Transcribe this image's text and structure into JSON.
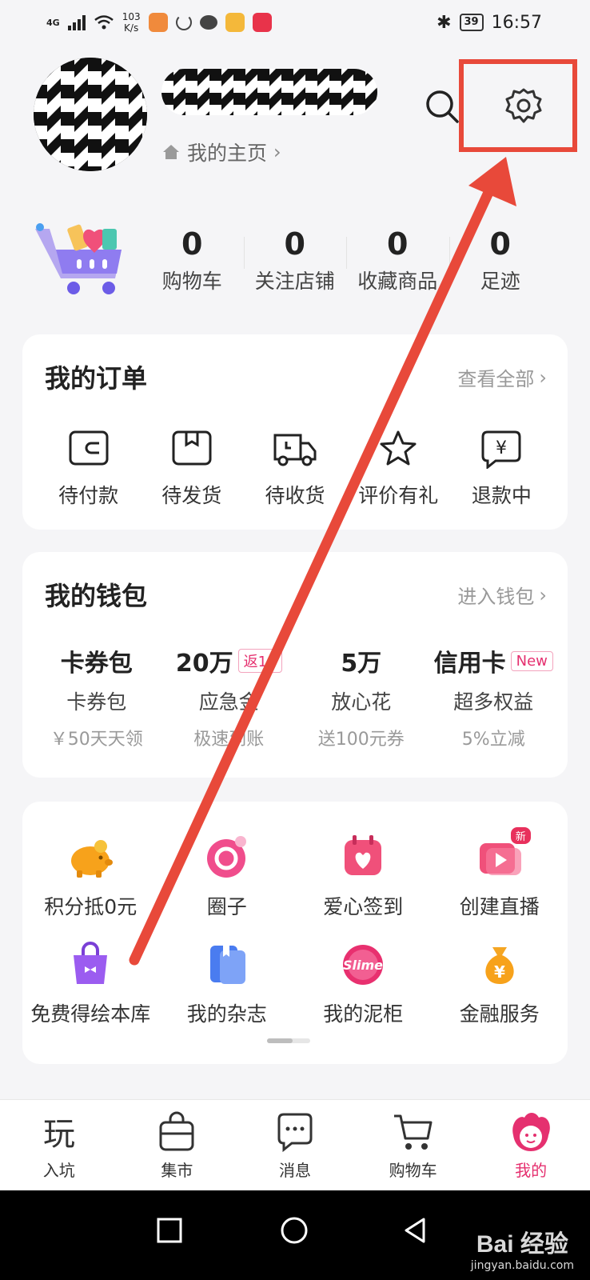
{
  "status_bar": {
    "network": "4G",
    "speed": "103",
    "speed_unit": "K/s",
    "battery": "39",
    "time": "16:57"
  },
  "profile": {
    "homepage_label": "我的主页"
  },
  "stats": [
    {
      "value": "0",
      "label": "购物车"
    },
    {
      "value": "0",
      "label": "关注店铺"
    },
    {
      "value": "0",
      "label": "收藏商品"
    },
    {
      "value": "0",
      "label": "足迹"
    }
  ],
  "orders": {
    "title": "我的订单",
    "view_all": "查看全部",
    "items": [
      {
        "label": "待付款",
        "icon": "wallet-icon"
      },
      {
        "label": "待发货",
        "icon": "package-icon"
      },
      {
        "label": "待收货",
        "icon": "truck-icon"
      },
      {
        "label": "评价有礼",
        "icon": "star-icon"
      },
      {
        "label": "退款中",
        "icon": "refund-icon"
      }
    ]
  },
  "wallet": {
    "title": "我的钱包",
    "enter": "进入钱包",
    "items": [
      {
        "value": "卡券包",
        "badge": "",
        "name": "卡券包",
        "sub": "￥50天天领"
      },
      {
        "value": "20万",
        "badge": "返18",
        "name": "应急金",
        "sub": "极速到账"
      },
      {
        "value": "5万",
        "badge": "",
        "name": "放心花",
        "sub": "送100元券"
      },
      {
        "value": "信用卡",
        "badge": "New",
        "name": "超多权益",
        "sub": "5%立减"
      }
    ]
  },
  "services": [
    {
      "label": "积分抵0元",
      "icon": "piggy-bank-icon"
    },
    {
      "label": "圈子",
      "icon": "circle-icon"
    },
    {
      "label": "爱心签到",
      "icon": "heart-calendar-icon"
    },
    {
      "label": "创建直播",
      "icon": "live-icon",
      "tag": "新"
    },
    {
      "label": "免费得绘本库",
      "icon": "gift-bag-icon"
    },
    {
      "label": "我的杂志",
      "icon": "magazine-icon"
    },
    {
      "label": "我的泥柜",
      "icon": "slime-icon"
    },
    {
      "label": "金融服务",
      "icon": "money-bag-icon"
    }
  ],
  "tabs": [
    {
      "label": "入坑",
      "icon": "play-icon"
    },
    {
      "label": "集市",
      "icon": "shopping-bag-icon"
    },
    {
      "label": "消息",
      "icon": "message-icon"
    },
    {
      "label": "购物车",
      "icon": "cart-icon"
    },
    {
      "label": "我的",
      "icon": "mine-icon",
      "active": true
    }
  ],
  "watermark": {
    "main": "Bai 经验",
    "sub": "jingyan.baidu.com"
  },
  "colors": {
    "accent": "#e5306f",
    "annotation": "#e8493a",
    "background": "#f5f5f7"
  }
}
